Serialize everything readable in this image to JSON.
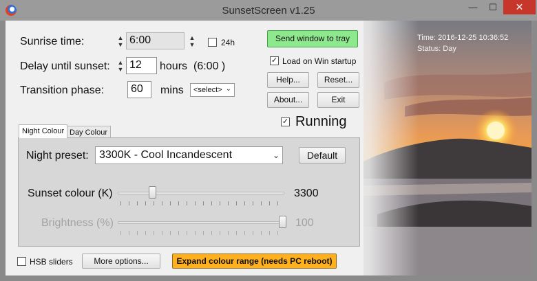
{
  "window": {
    "title": "SunsetScreen v1.25",
    "minimize_glyph": "—",
    "maximize_glyph": "☐",
    "close_glyph": "✕"
  },
  "schedule": {
    "sunrise_label": "Sunrise time:",
    "sunrise_value": "6:00",
    "option_24h_label": "24h",
    "option_24h_checked": false,
    "delay_label": "Delay until sunset:",
    "delay_value": "12",
    "delay_unit": "hours",
    "delay_note": "(6:00 )",
    "transition_label": "Transition phase:",
    "transition_value": "60",
    "transition_unit": "mins",
    "transition_select": "<select>"
  },
  "actions": {
    "tray_button": "Send window to tray",
    "load_on_startup_label": "Load on Win startup",
    "load_on_startup_checked": true,
    "help_button": "Help...",
    "reset_button": "Reset...",
    "about_button": "About...",
    "exit_button": "Exit",
    "running_label": "Running",
    "running_checked": true
  },
  "info": {
    "time": "Time: 2016-12-25 10:36:52",
    "status": "Status: Day"
  },
  "tabs": [
    {
      "label": "Night Colour",
      "active": true
    },
    {
      "label": "Day Colour",
      "active": false
    }
  ],
  "night_panel": {
    "preset_label": "Night preset:",
    "preset_value": "3300K - Cool Incandescent",
    "default_button": "Default",
    "sunset_colour_label": "Sunset colour (K)",
    "sunset_colour_value": "3300",
    "sunset_colour_fraction": 0.2,
    "brightness_label": "Brightness (%)",
    "brightness_value": "100",
    "brightness_fraction": 1.0
  },
  "footer": {
    "hsb_label": "HSB sliders",
    "hsb_checked": false,
    "more_options_button": "More options...",
    "expand_button": "Expand colour range (needs PC reboot)"
  },
  "check_glyph": "✓",
  "colors": {
    "accent_green": "#8ee88e",
    "accent_orange": "#ffb01f",
    "close_red": "#c7362a"
  }
}
